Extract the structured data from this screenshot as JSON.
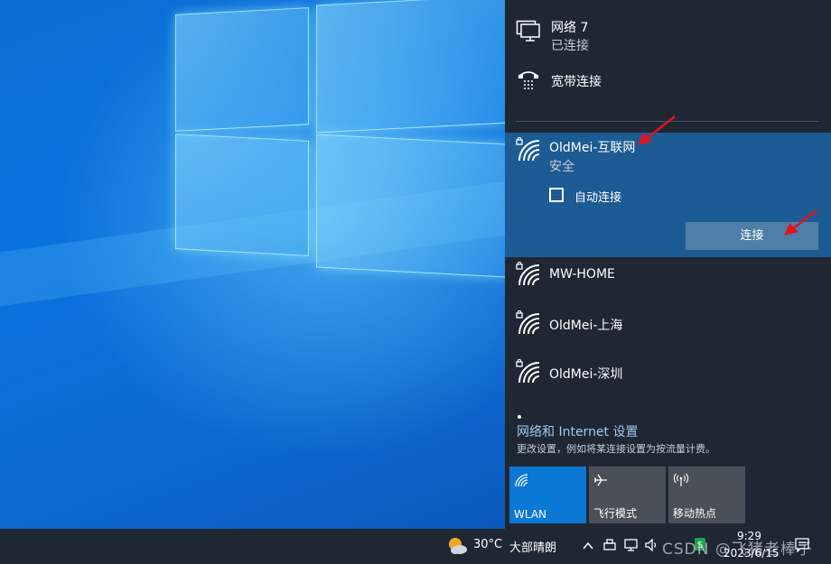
{
  "flyout": {
    "wired": {
      "name": "网络 7",
      "status": "已连接"
    },
    "broadband": {
      "name": "宽带连接"
    },
    "selected": {
      "ssid": "OldMei-互联网",
      "security": "安全",
      "auto_connect_label": "自动连接",
      "auto_connect_checked": false,
      "connect_label": "连接"
    },
    "networks": [
      {
        "ssid": "MW-HOME"
      },
      {
        "ssid": "OldMei-上海"
      },
      {
        "ssid": "OldMei-深圳"
      }
    ],
    "settings_link": "网络和 Internet 设置",
    "settings_desc": "更改设置，例如将某连接设置为按流量计费。",
    "quick_actions": [
      {
        "label": "WLAN",
        "icon": "wifi-icon",
        "active": true
      },
      {
        "label": "飞行模式",
        "icon": "airplane-icon",
        "active": false
      },
      {
        "label": "移动热点",
        "icon": "hotspot-icon",
        "active": false
      }
    ]
  },
  "taskbar": {
    "weather_temp": "30°C",
    "weather_condition": "大部晴朗",
    "time": "9:29",
    "date": "2023/6/15",
    "watermark": "CSDN @飞猪老棒子"
  },
  "colors": {
    "flyout_bg": "#1f2733",
    "selected_bg": "#1d5b94",
    "accent": "#0a78d4",
    "link": "#9cc9f2",
    "annotation_arrow": "#e0141e"
  }
}
